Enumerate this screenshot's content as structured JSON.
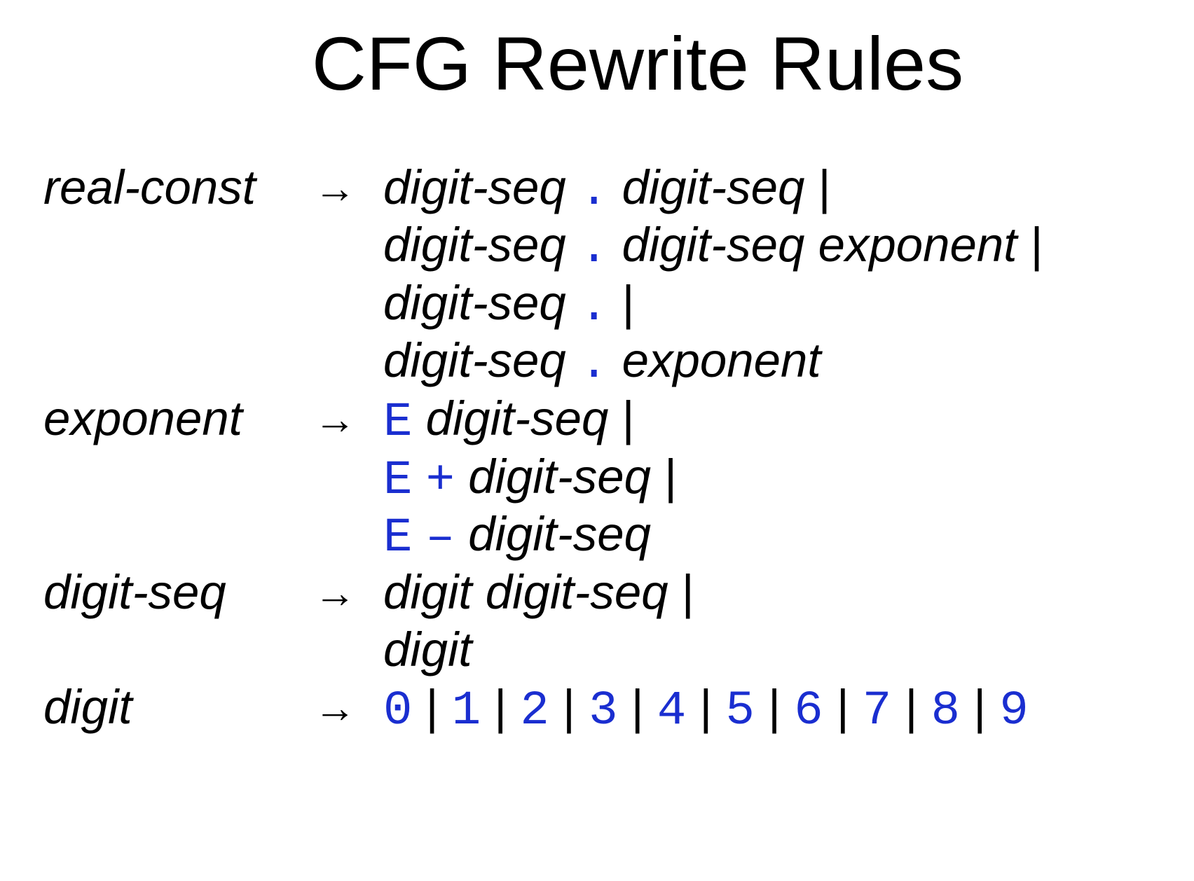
{
  "title": "CFG Rewrite Rules",
  "arrow_symbol": "→",
  "bar_symbol": "|",
  "rules": [
    {
      "lhs": "real-const",
      "alternatives": [
        [
          {
            "k": "nt",
            "v": "digit-seq"
          },
          {
            "k": "t",
            "v": "."
          },
          {
            "k": "nt",
            "v": "digit-seq"
          },
          {
            "k": "bar",
            "v": "|"
          }
        ],
        [
          {
            "k": "nt",
            "v": "digit-seq"
          },
          {
            "k": "t",
            "v": "."
          },
          {
            "k": "nt",
            "v": "digit-seq"
          },
          {
            "k": "nt",
            "v": "exponent"
          },
          {
            "k": "bar",
            "v": "|"
          }
        ],
        [
          {
            "k": "nt",
            "v": "digit-seq"
          },
          {
            "k": "t",
            "v": "."
          },
          {
            "k": "bar",
            "v": "|"
          }
        ],
        [
          {
            "k": "nt",
            "v": "digit-seq"
          },
          {
            "k": "t",
            "v": "."
          },
          {
            "k": "nt",
            "v": "exponent"
          }
        ]
      ]
    },
    {
      "lhs": "exponent",
      "alternatives": [
        [
          {
            "k": "t",
            "v": "E"
          },
          {
            "k": "nt",
            "v": "digit-seq"
          },
          {
            "k": "bar",
            "v": "|"
          }
        ],
        [
          {
            "k": "t",
            "v": "E"
          },
          {
            "k": "t",
            "v": "+"
          },
          {
            "k": "nt",
            "v": "digit-seq"
          },
          {
            "k": "bar",
            "v": "|"
          }
        ],
        [
          {
            "k": "t",
            "v": "E"
          },
          {
            "k": "t",
            "v": "–"
          },
          {
            "k": "nt",
            "v": "digit-seq"
          }
        ]
      ]
    },
    {
      "lhs": "digit-seq",
      "alternatives": [
        [
          {
            "k": "nt",
            "v": "digit"
          },
          {
            "k": "nt",
            "v": "digit-seq"
          },
          {
            "k": "bar",
            "v": "|"
          }
        ],
        [
          {
            "k": "nt",
            "v": "digit"
          }
        ]
      ]
    },
    {
      "lhs": "digit",
      "alternatives": [
        [
          {
            "k": "t",
            "v": "0"
          },
          {
            "k": "bar",
            "v": "|"
          },
          {
            "k": "t",
            "v": "1"
          },
          {
            "k": "bar",
            "v": "|"
          },
          {
            "k": "t",
            "v": "2"
          },
          {
            "k": "bar",
            "v": "|"
          },
          {
            "k": "t",
            "v": "3"
          },
          {
            "k": "bar",
            "v": "|"
          },
          {
            "k": "t",
            "v": "4"
          },
          {
            "k": "bar",
            "v": "|"
          },
          {
            "k": "t",
            "v": "5"
          },
          {
            "k": "bar",
            "v": "|"
          },
          {
            "k": "t",
            "v": "6"
          },
          {
            "k": "bar",
            "v": "|"
          },
          {
            "k": "t",
            "v": "7"
          },
          {
            "k": "bar",
            "v": "|"
          },
          {
            "k": "t",
            "v": "8"
          },
          {
            "k": "bar",
            "v": "|"
          },
          {
            "k": "t",
            "v": "9"
          }
        ]
      ]
    }
  ],
  "colors": {
    "terminal": "#1a2ed0",
    "text": "#000000",
    "background": "#ffffff"
  }
}
